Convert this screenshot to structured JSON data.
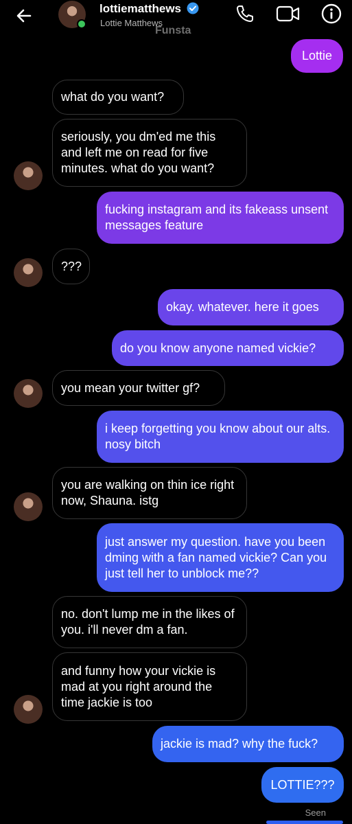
{
  "header": {
    "username": "lottiematthews",
    "full_name": "Lottie Matthews",
    "watermark": "Funsta",
    "online": true
  },
  "messages": [
    {
      "from": "outgoing",
      "text": "Lottie"
    },
    {
      "from": "incoming",
      "text": "what do you want?"
    },
    {
      "from": "incoming",
      "text": "seriously, you dm'ed me this and left me on read for five minutes. what do you want?"
    },
    {
      "from": "outgoing",
      "text": "fucking instagram and its fakeass unsent messages feature"
    },
    {
      "from": "incoming",
      "text": "???"
    },
    {
      "from": "outgoing",
      "text": "okay. whatever. here it goes"
    },
    {
      "from": "outgoing",
      "text": "do you know anyone named vickie?"
    },
    {
      "from": "incoming",
      "text": "you mean your twitter gf?"
    },
    {
      "from": "outgoing",
      "text": "i keep forgetting you know about our alts. nosy bitch"
    },
    {
      "from": "incoming",
      "text": "you are walking on thin ice right now, Shauna. istg"
    },
    {
      "from": "outgoing",
      "text": "just answer my question. have you been dming with a fan named vickie? Can you just tell her to unblock me??"
    },
    {
      "from": "incoming",
      "text": "no. don't lump me in the likes of you. i'll never dm a fan."
    },
    {
      "from": "incoming",
      "text": "and funny how your vickie is mad at you right around the time jackie is too"
    },
    {
      "from": "outgoing",
      "text": "jackie is mad? why the fuck?"
    },
    {
      "from": "outgoing",
      "text": "LOTTIE???"
    }
  ],
  "status": {
    "seen": "Seen"
  },
  "colors": {
    "incoming_bubble_border": "#363636",
    "outgoing_purple": "#8a2be2",
    "outgoing_blue": "#2f6df0",
    "verified": "#3897f0",
    "online": "#3cc55b"
  }
}
